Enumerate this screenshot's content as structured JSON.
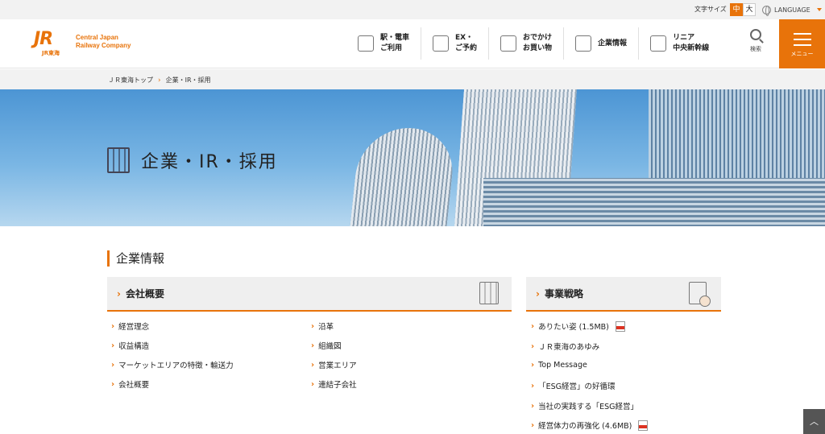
{
  "utility": {
    "font_size_label": "文字サイズ",
    "font_mid": "中",
    "font_big": "大",
    "language": "LANGUAGE"
  },
  "header": {
    "logo_mark": "JR",
    "logo_sub": "JR東海",
    "logo_name_line1": "Central Japan",
    "logo_name_line2": "Railway Company",
    "nav": [
      {
        "label": "駅・電車\nご利用",
        "icon": "train-station-icon"
      },
      {
        "label": "EX・\nご予約",
        "icon": "reservation-icon"
      },
      {
        "label": "おでかけ\nお買い物",
        "icon": "shopping-icon"
      },
      {
        "label": "企業情報",
        "icon": "building-icon"
      },
      {
        "label": "リニア\n中央新幹線",
        "icon": "maglev-icon"
      }
    ],
    "search_label": "検索",
    "menu_label": "メニュー"
  },
  "breadcrumb": {
    "home": "ＪＲ東海トップ",
    "current": "企業・IR・採用"
  },
  "hero": {
    "title": "企業・IR・採用"
  },
  "section": {
    "title": "企業情報"
  },
  "card_company": {
    "title": "会社概要",
    "links_left": [
      "経営理念",
      "収益構造",
      "マーケットエリアの特徴・輸送力",
      "会社概要"
    ],
    "links_right": [
      "沿革",
      "組織図",
      "営業エリア",
      "連結子会社"
    ]
  },
  "card_strategy": {
    "title": "事業戦略",
    "links": [
      {
        "label": "ありたい姿 (1.5MB)",
        "pdf": true
      },
      {
        "label": "ＪＲ東海のあゆみ",
        "pdf": false
      },
      {
        "label": "Top Message",
        "pdf": false
      },
      {
        "label": "「ESG経営」の好循環",
        "pdf": false
      },
      {
        "label": "当社の実践する「ESG経営」",
        "pdf": false
      },
      {
        "label": "経営体力の再強化 (4.6MB)",
        "pdf": true
      }
    ]
  },
  "colors": {
    "accent": "#e8730a",
    "header_bg": "#ffffff",
    "utility_bg": "#f2f2f2"
  }
}
